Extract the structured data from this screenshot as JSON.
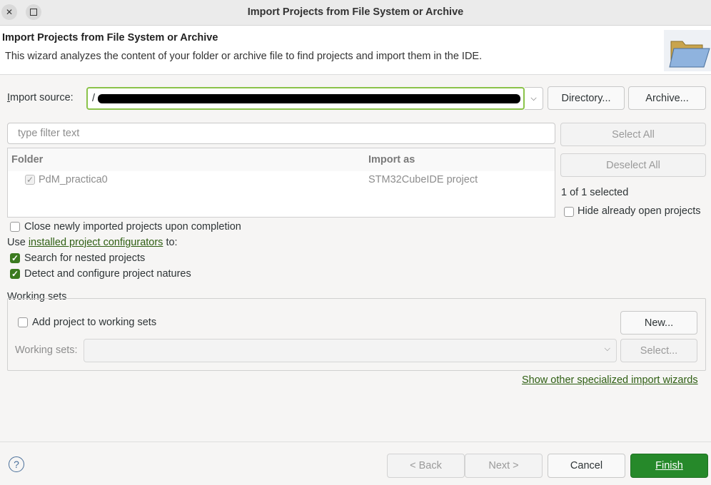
{
  "window": {
    "title": "Import Projects from File System or Archive"
  },
  "header": {
    "title": "Import Projects from File System or Archive",
    "description": "This wizard analyzes the content of your folder or archive file to find projects and import them in the IDE."
  },
  "import_source": {
    "label": "Import source:",
    "value": "/",
    "directory_button": "Directory...",
    "archive_button": "Archive..."
  },
  "filter": {
    "placeholder": "type filter text"
  },
  "table": {
    "columns": [
      "Folder",
      "Import as"
    ],
    "rows": [
      {
        "folder": "PdM_practica0",
        "import_as": "STM32CubeIDE project",
        "checked": true
      }
    ]
  },
  "side": {
    "select_all": "Select All",
    "deselect_all": "Deselect All",
    "selection_count": "1 of 1 selected",
    "hide_open": "Hide already open projects"
  },
  "options": {
    "close_newly": "Close newly imported projects upon completion",
    "use_prefix": "Use ",
    "configurators_link": "installed project configurators",
    "use_suffix": " to:",
    "search_nested": "Search for nested projects",
    "detect_configure": "Detect and configure project natures"
  },
  "working_sets": {
    "title": "Working sets",
    "add_label": "Add project to working sets",
    "new_button": "New...",
    "sets_label": "Working sets:",
    "select_button": "Select..."
  },
  "other_wizards_link": "Show other specialized import wizards",
  "footer": {
    "help": "?",
    "back": "< Back",
    "next": "Next >",
    "cancel": "Cancel",
    "finish": "Finish"
  },
  "colors": {
    "accent": "#26892a",
    "link": "#2e5e12",
    "focus_border": "#8bc34a"
  }
}
